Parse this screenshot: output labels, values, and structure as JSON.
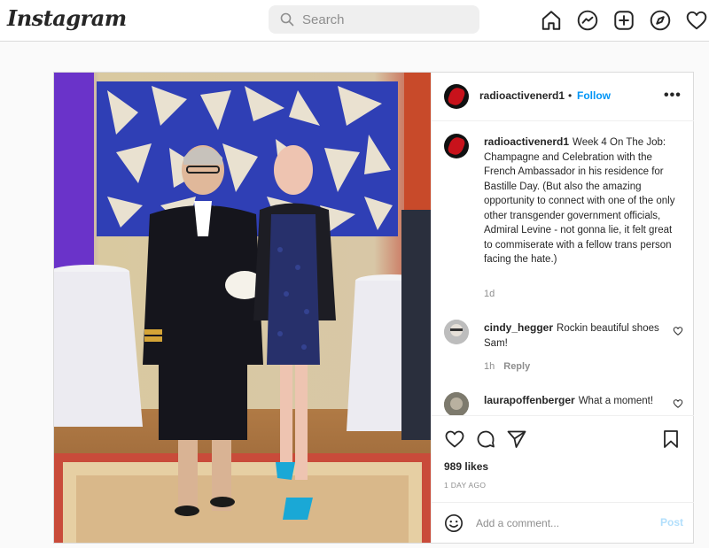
{
  "nav": {
    "logo": "Instagram",
    "search_placeholder": "Search",
    "icons": [
      "home-icon",
      "messenger-icon",
      "new-post-icon",
      "explore-icon",
      "activity-heart-icon"
    ]
  },
  "post": {
    "header": {
      "username": "radioactivenerd1",
      "separator": "•",
      "follow_label": "Follow",
      "more_label": "•••"
    },
    "caption": {
      "username": "radioactivenerd1",
      "text": "Week 4 On The Job: Champagne and Celebration with the French Ambassador in his residence for Bastille Day. (But also the amazing opportunity to connect with one of the only other transgender government officials, Admiral Levine - not gonna lie, it felt great to commiserate with a fellow trans person facing the hate.)",
      "age": "1d"
    },
    "comments": [
      {
        "username": "cindy_hegger",
        "text": "Rockin beautiful shoes Sam!",
        "age": "1h",
        "reply_label": "Reply"
      },
      {
        "username": "laurapoffenberger",
        "text": "What a moment!"
      }
    ],
    "likes": "989 likes",
    "date": "1 DAY AGO",
    "add_comment_placeholder": "Add a comment...",
    "post_label": "Post"
  },
  "colors": {
    "accent": "#0095f6",
    "post_disabled": "#b2dffc",
    "muted": "#8e8e8e",
    "text": "#262626"
  }
}
